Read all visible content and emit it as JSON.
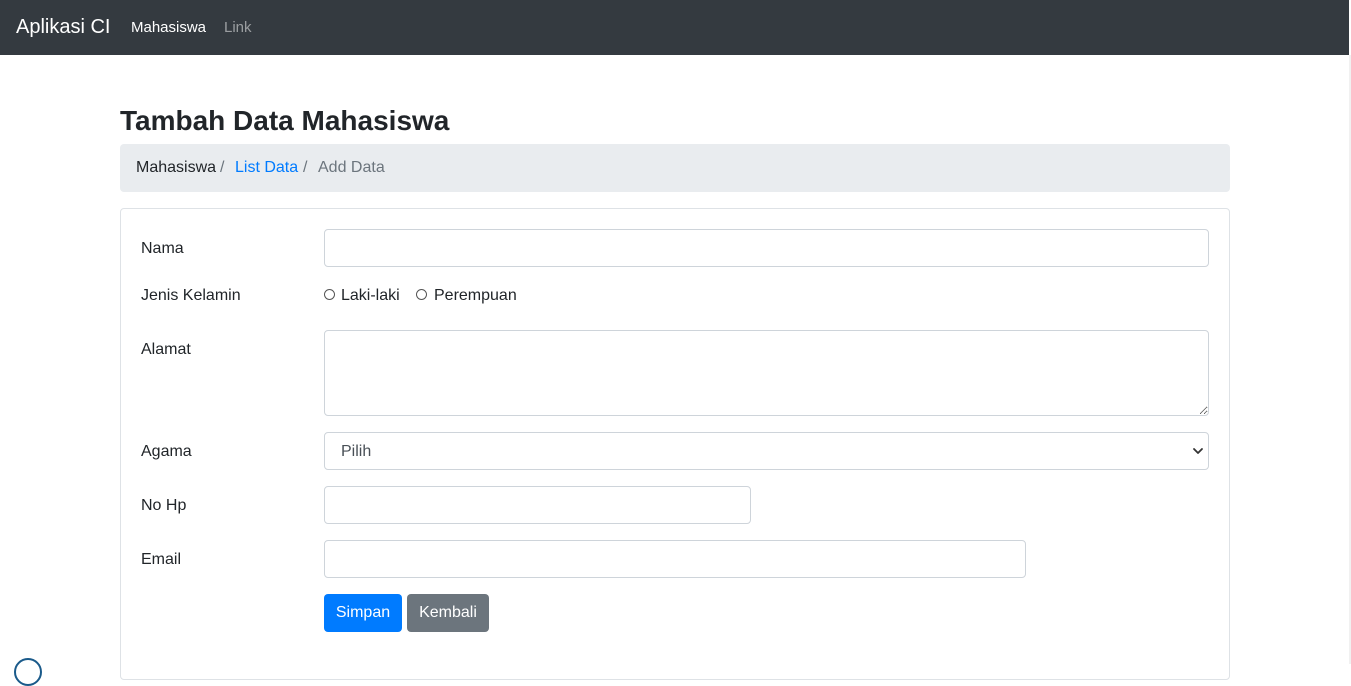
{
  "navbar": {
    "brand": "Aplikasi CI",
    "links": [
      {
        "label": "Mahasiswa",
        "active": true
      },
      {
        "label": "Link",
        "active": false
      }
    ]
  },
  "page": {
    "title": "Tambah Data Mahasiswa"
  },
  "breadcrumb": {
    "items": [
      {
        "label": "Mahasiswa",
        "type": "text"
      },
      {
        "label": "List Data",
        "type": "link"
      },
      {
        "label": "Add Data",
        "type": "active"
      }
    ],
    "separator": "/"
  },
  "form": {
    "nama": {
      "label": "Nama",
      "value": "",
      "placeholder": ""
    },
    "jenis_kelamin": {
      "label": "Jenis Kelamin",
      "options": [
        {
          "label": "Laki-laki",
          "checked": false
        },
        {
          "label": "Perempuan",
          "checked": false
        }
      ]
    },
    "alamat": {
      "label": "Alamat",
      "value": ""
    },
    "agama": {
      "label": "Agama",
      "selected": "Pilih"
    },
    "no_hp": {
      "label": "No Hp",
      "value": ""
    },
    "email": {
      "label": "Email",
      "value": ""
    },
    "buttons": {
      "submit": "Simpan",
      "back": "Kembali"
    }
  },
  "colors": {
    "navbar_bg": "#343a40",
    "primary": "#007bff",
    "secondary": "#6c757d",
    "breadcrumb_bg": "#e9ecef"
  },
  "icons": {
    "select_arrow": "chevron-down-icon",
    "radio": "radio-icon"
  }
}
